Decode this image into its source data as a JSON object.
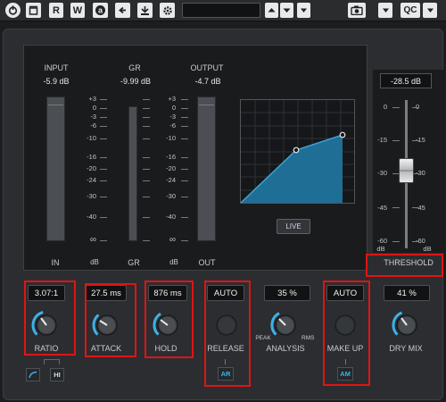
{
  "toolbar": {
    "buttons": [
      "R",
      "W",
      "QC"
    ],
    "icons": [
      "power-icon",
      "bypass-icon",
      "read-automation",
      "write-automation",
      "a-b-compare-icon",
      "copy-settings-icon",
      "side-chain-icon",
      "settings-gear-icon",
      "preset-up-down-icon",
      "preset-menu-icon",
      "camera-icon",
      "dropdown-icon",
      "qc-button",
      "window-menu-icon"
    ],
    "preset_name": ""
  },
  "meters": {
    "input_label": "INPUT",
    "input_value": "-5.9 dB",
    "gr_label": "GR",
    "gr_value": "-9.99 dB",
    "output_label": "OUTPUT",
    "output_value": "-4.7 dB",
    "scale_in": [
      "+3",
      "0",
      "-3",
      "-6",
      "-10",
      "-16",
      "-20",
      "-24",
      "-30",
      "-40",
      "∞"
    ],
    "scale_out": [
      "+3",
      "0",
      "-3",
      "-6",
      "-10",
      "-16",
      "-20",
      "-24",
      "-30",
      "-40",
      "∞"
    ],
    "bottom_in": "IN",
    "bottom_db1": "dB",
    "bottom_gr": "GR",
    "bottom_db2": "dB",
    "bottom_out": "OUT"
  },
  "graph": {
    "live_label": "LIVE"
  },
  "threshold": {
    "readout": "-28.5 dB",
    "label": "THRESHOLD",
    "scale_left": [
      "0",
      "-15",
      "-30",
      "-45",
      "-60"
    ],
    "scale_right": [
      "0",
      "-15",
      "-30",
      "-45",
      "-60"
    ],
    "unit_left": "dB",
    "unit_right": "dB",
    "value_db": -28.5
  },
  "params": {
    "ratio_value": "3.07:1",
    "ratio_label": "RATIO",
    "attack_value": "27.5 ms",
    "attack_label": "ATTACK",
    "hold_value": "876 ms",
    "hold_label": "HOLD",
    "release_value": "AUTO",
    "release_label": "RELEASE",
    "analysis_value": "35 %",
    "analysis_label": "ANALYSIS",
    "analysis_peak": "PEAK",
    "analysis_rms": "RMS",
    "makeup_value": "AUTO",
    "makeup_label": "MAKE UP",
    "drymix_value": "41 %",
    "drymix_label": "DRY MIX"
  },
  "small_buttons": {
    "ar": "AR",
    "am": "AM",
    "hi": "HI"
  },
  "colors": {
    "accent": "#3db2e8",
    "curve_fill": "#1f6e96",
    "highlight": "#e01414"
  }
}
